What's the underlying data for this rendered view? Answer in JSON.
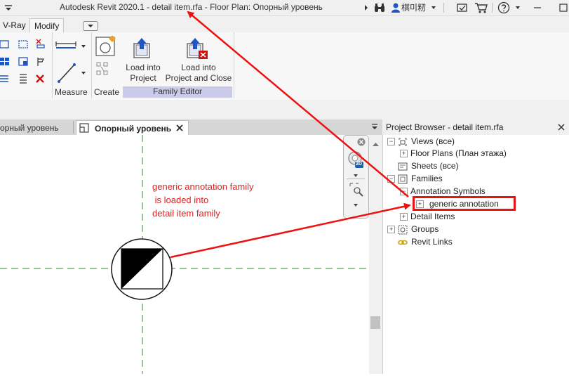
{
  "window": {
    "title": "Autodesk Revit 2020.1 - detail item.rfa - Floor Plan: Опорный уровень",
    "user_name": "棋미籾"
  },
  "ribbon": {
    "tabs": [
      {
        "label": "V-Ray"
      },
      {
        "label": "Modify"
      }
    ],
    "measure_label": "Measure",
    "create_label": "Create",
    "load_into_project": "Load into\nProject",
    "load_into_project_line1": "Load into",
    "load_into_project_line2": "Project",
    "load_close_line1": "Load into",
    "load_close_line2": "Project and Close",
    "family_editor_label": "Family Editor"
  },
  "view_tabs": {
    "inactive_label": "орный уровень",
    "active_label": "Опорный уровень"
  },
  "project_browser": {
    "header": "Project Browser - detail item.rfa",
    "tree": {
      "views": "Views (все)",
      "floor_plans": "Floor Plans (План этажа)",
      "sheets": "Sheets (все)",
      "families": "Families",
      "annotation_symbols": "Annotation Symbols",
      "generic_annotation": "generic annotation",
      "detail_items": "Detail Items",
      "groups": "Groups",
      "revit_links": "Revit Links"
    }
  },
  "annotation": {
    "line1": "generic annotation family",
    "line2": " is loaded into",
    "line3": "detail item family"
  },
  "navbar": {
    "zoom_badge": "2D"
  },
  "colors": {
    "arrow": "#ee1111",
    "family_editor_bg": "#c9cbe8",
    "reference_line": "#2e8b2e"
  }
}
